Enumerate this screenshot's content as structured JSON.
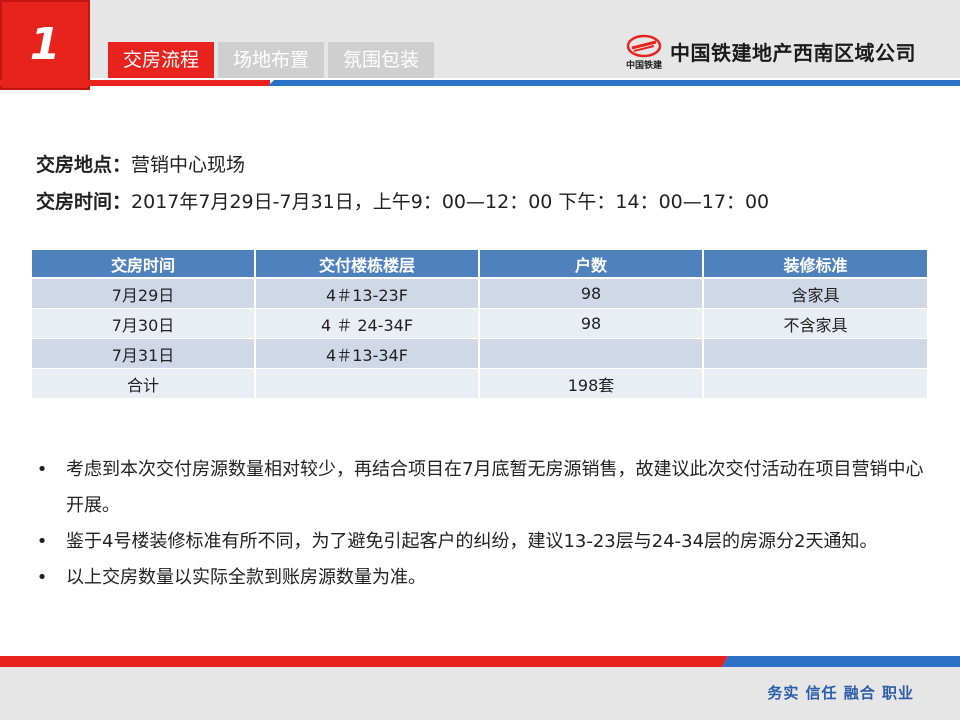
{
  "header": {
    "section_number": "1",
    "tabs": [
      {
        "label": "交房流程",
        "active": true
      },
      {
        "label": "场地布置",
        "active": false
      },
      {
        "label": "氛围包装",
        "active": false
      }
    ],
    "logo_small_text": "中国铁建",
    "company_name": "中国铁建地产西南区域公司"
  },
  "info": {
    "location_label": "交房地点：",
    "location_value": "营销中心现场",
    "time_label": "交房时间：",
    "time_value": "2017年7月29日-7月31日，上午9：00—12：00  下午：14：00—17：00"
  },
  "table": {
    "headers": [
      "交房时间",
      "交付楼栋楼层",
      "户数",
      "装修标准"
    ],
    "rows": [
      [
        "7月29日",
        "4＃13-23F",
        "98",
        "含家具"
      ],
      [
        "7月30日",
        "4 ＃ 24-34F",
        "98",
        "不含家具"
      ],
      [
        "7月31日",
        "4＃13-34F",
        "",
        ""
      ],
      [
        "合计",
        "",
        "198套",
        ""
      ]
    ]
  },
  "bullets": [
    "考虑到本次交付房源数量相对较少，再结合项目在7月底暂无房源销售，故建议此次交付活动在项目营销中心开展。",
    "鉴于4号楼装修标准有所不同，为了避免引起客户的纠纷，建议13-23层与24-34层的房源分2天通知。",
    "以上交房数量以实际全款到账房源数量为准。"
  ],
  "bullet_glyph": "•",
  "footer": {
    "slogan": "务实  信任  融合  职业"
  },
  "colors": {
    "brand_red": "#e8231e",
    "brand_blue": "#2b72c7",
    "table_header": "#4f81bd",
    "row_odd": "#d0d8e8",
    "row_even": "#e9edf4"
  }
}
